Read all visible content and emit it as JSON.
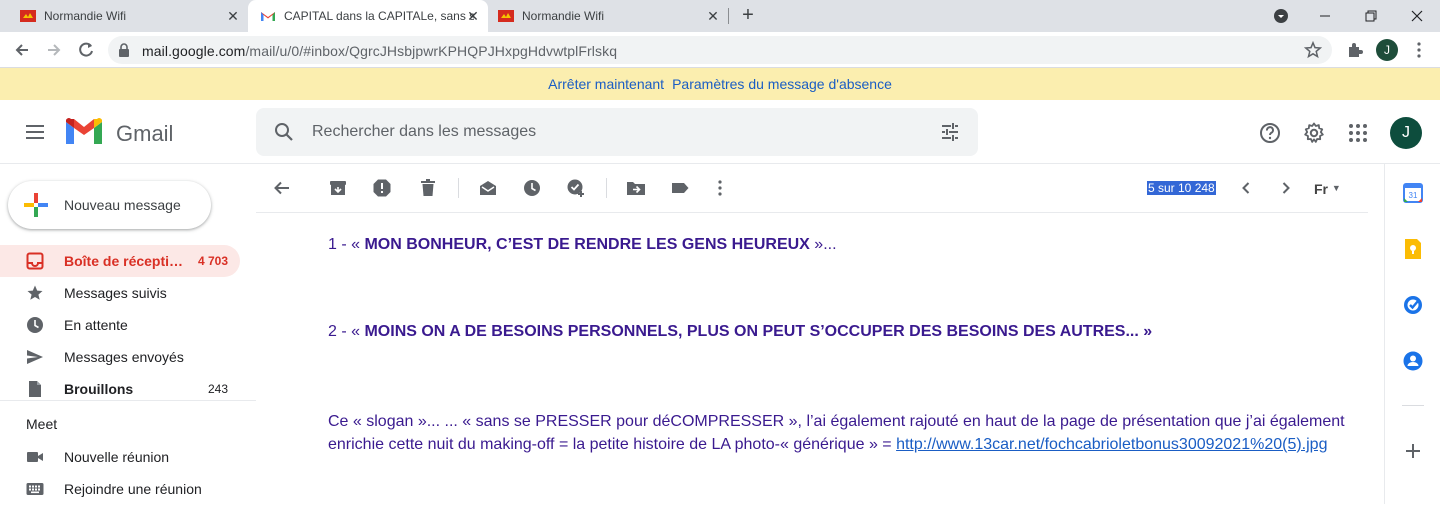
{
  "browser": {
    "tabs": [
      {
        "title": "Normandie Wifi",
        "active": false
      },
      {
        "title": "CAPITAL dans la CAPITALe, sans s",
        "active": true
      },
      {
        "title": "Normandie Wifi",
        "active": false
      }
    ],
    "url_host": "mail.google.com",
    "url_path": "/mail/u/0/#inbox/QgrcJHsbjpwrKPHQPJHxpgHdvwtplFrlskq",
    "profile_initial": "J"
  },
  "banner": {
    "stop_link": "Arrêter maintenant",
    "settings_link": "Paramètres du message d'absence"
  },
  "header": {
    "app_name": "Gmail",
    "search_placeholder": "Rechercher dans les messages",
    "avatar_initial": "J"
  },
  "sidebar": {
    "compose_label": "Nouveau message",
    "items": [
      {
        "label": "Boîte de récepti…",
        "count": "4 703",
        "icon": "inbox-icon"
      },
      {
        "label": "Messages suivis",
        "count": "",
        "icon": "star-icon"
      },
      {
        "label": "En attente",
        "count": "",
        "icon": "clock-icon"
      },
      {
        "label": "Messages envoyés",
        "count": "",
        "icon": "send-icon"
      },
      {
        "label": "Brouillons",
        "count": "243",
        "icon": "draft-icon"
      }
    ],
    "meet_heading": "Meet",
    "meet_items": [
      {
        "label": "Nouvelle réunion",
        "icon": "video-icon"
      },
      {
        "label": "Rejoindre une réunion",
        "icon": "keyboard-icon"
      }
    ]
  },
  "message_toolbar": {
    "pager": "5 sur 10 248",
    "language": "Fr"
  },
  "message": {
    "line1_prefix": "1 - « ",
    "line1_bold": "MON BONHEUR, C’EST DE RENDRE LES GENS HEUREUX",
    "line1_suffix": " »...",
    "line2_prefix": "2 - « ",
    "line2_bold": "MOINS ON A DE BESOINS PERSONNELS, PLUS ON PEUT S’OCCUPER DES BESOINS DES AUTRES... »",
    "para_text": "Ce « slogan »... ... « sans se PRESSER pour déCOMPRESSER », l’ai également rajouté en haut de la page de présentation que j’ai également enrichie cette nuit du making-off = la petite histoire de LA photo-« générique » = ",
    "para_link": "http://www.13car.net/fochcabrioletbonus30092021%20(5).jpg"
  },
  "colors": {
    "accent_red": "#d93025",
    "message_text": "#3a1a8f",
    "link_blue": "#1a5dc4",
    "banner_bg": "#fbeeaf"
  }
}
